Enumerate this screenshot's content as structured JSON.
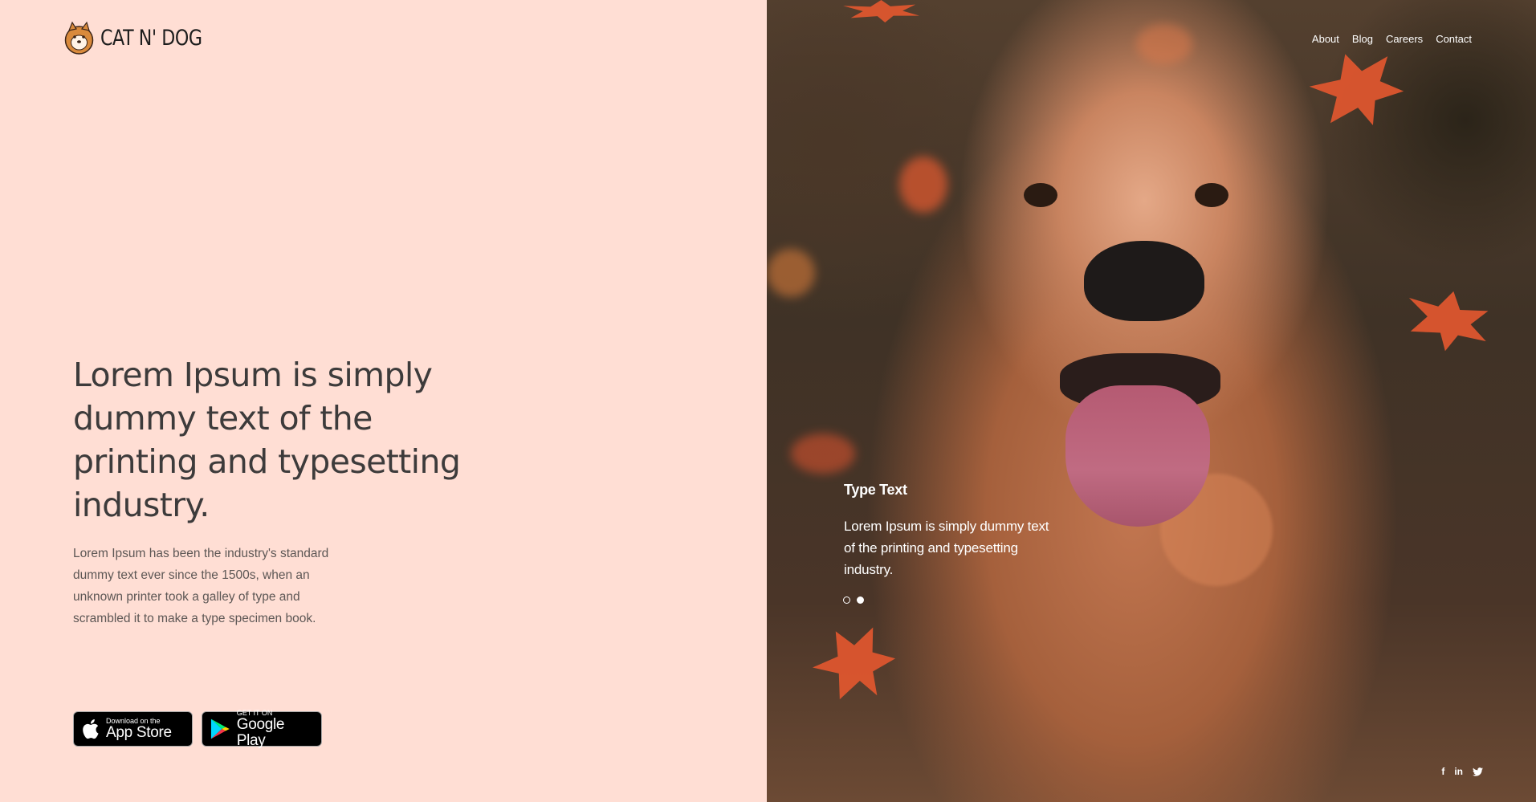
{
  "brand": {
    "logo_text": "CAT N' DOG"
  },
  "nav": {
    "items": [
      "About",
      "Blog",
      "Careers",
      "Contact"
    ]
  },
  "hero": {
    "headline": "Lorem Ipsum is simply dummy text of the printing and typesetting industry.",
    "description": "Lorem Ipsum has been the industry's standard dummy text ever since the 1500s, when an unknown printer took a galley of type and scrambled it to make a type specimen book."
  },
  "stores": {
    "apple": {
      "small": "Download on the",
      "big": "App Store"
    },
    "google": {
      "small": "GET IT ON",
      "big": "Google Play"
    }
  },
  "slider": {
    "title": "Type Text",
    "text": "Lorem Ipsum is simply dummy text of the printing and typesetting industry.",
    "dots": 2,
    "active_index": 1
  },
  "social": {
    "facebook": "f",
    "linkedin": "in"
  },
  "colors": {
    "left_bg": "#ffded4",
    "headline": "#3d3b3b",
    "text": "#5d5755"
  }
}
